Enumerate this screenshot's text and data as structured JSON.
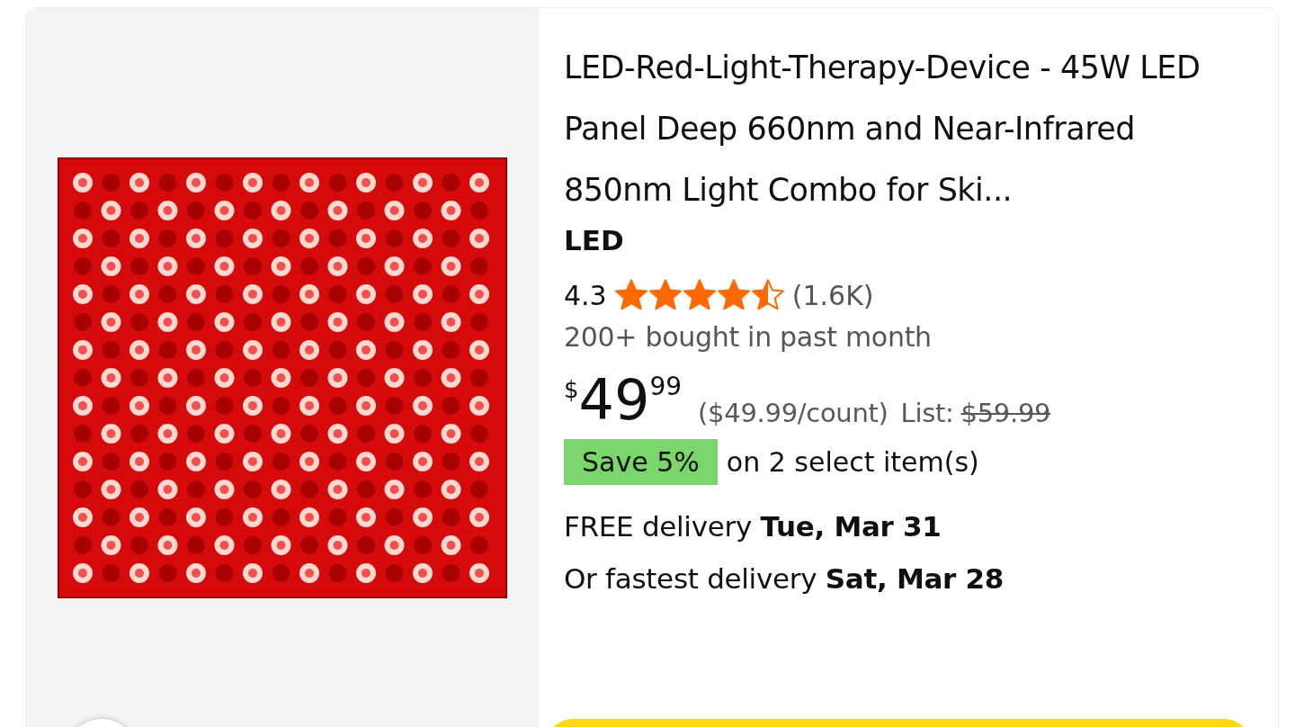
{
  "product": {
    "title": "LED-Red-Light-Therapy-Device - 45W LED Panel Deep 660nm and Near-Infrared 850nm Light Combo for Ski...",
    "brand": "LED",
    "rating": {
      "value": "4.3",
      "stars": 4.5,
      "count": "(1.6K)"
    },
    "bought": "200+ bought in past month",
    "price": {
      "currency": "$",
      "whole": "49",
      "fraction": "99",
      "unit_price": "($49.99/count)",
      "list_label": "List:",
      "list_price": "$59.99"
    },
    "coupon": {
      "badge": "Save 5%",
      "text": "on 2 select item(s)"
    },
    "delivery": [
      {
        "label": "FREE delivery ",
        "date": "Tue, Mar 31"
      },
      {
        "label": "Or fastest delivery ",
        "date": "Sat, Mar 28"
      }
    ]
  }
}
